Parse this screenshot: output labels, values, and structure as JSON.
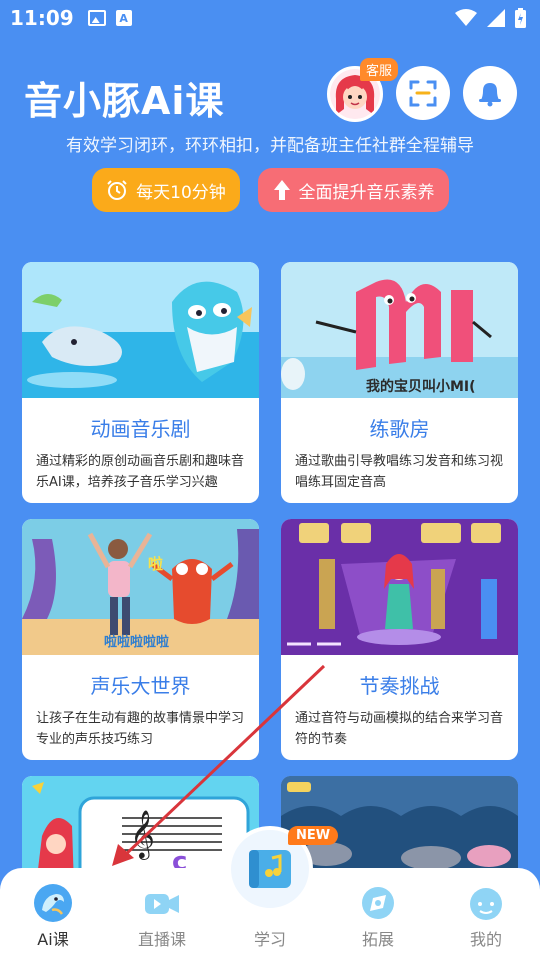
{
  "status_bar": {
    "time": "11:09",
    "icons": [
      "image-icon",
      "a-icon",
      "wifi-icon",
      "signal-icon",
      "battery-icon"
    ]
  },
  "header": {
    "title": "音小豚Ai课",
    "kefu_badge": "客服",
    "subtitle": "有效学习闭环，环环相扣，并配备班主任社群全程辅导",
    "pill_1": "每天10分钟",
    "pill_2": "全面提升音乐素养"
  },
  "cards": [
    {
      "title": "动画音乐剧",
      "desc": "通过精彩的原创动画音乐剧和趣味音乐AI课，培养孩子音乐学习兴趣"
    },
    {
      "title": "练歌房",
      "desc": "通过歌曲引导教唱练习发音和练习视唱练耳固定音高",
      "image_text": "我的宝贝叫小MI("
    },
    {
      "title": "声乐大世界",
      "desc": "让孩子在生动有趣的故事情景中学习专业的声乐技巧练习",
      "image_text": "啦",
      "image_caption": "啦啦啦啦啦"
    },
    {
      "title": "节奏挑战",
      "desc": "通过音符与动画模拟的结合来学习音符的节奏"
    },
    {
      "title": "",
      "desc": ""
    },
    {
      "title": "",
      "desc": ""
    }
  ],
  "tabs": [
    {
      "label": "Ai课",
      "icon": "dolphin-icon"
    },
    {
      "label": "直播课",
      "icon": "video-camera-icon"
    },
    {
      "label": "学习",
      "icon": "music-book-icon"
    },
    {
      "label": "拓展",
      "icon": "expand-icon"
    },
    {
      "label": "我的",
      "icon": "profile-face-icon"
    }
  ],
  "new_badge": "NEW",
  "colors": {
    "background": "#4a8ff2",
    "accent_blue": "#3a7ee8",
    "orange": "#fbaa1a",
    "pink": "#f76d75",
    "annotation_red": "#d9353b"
  }
}
